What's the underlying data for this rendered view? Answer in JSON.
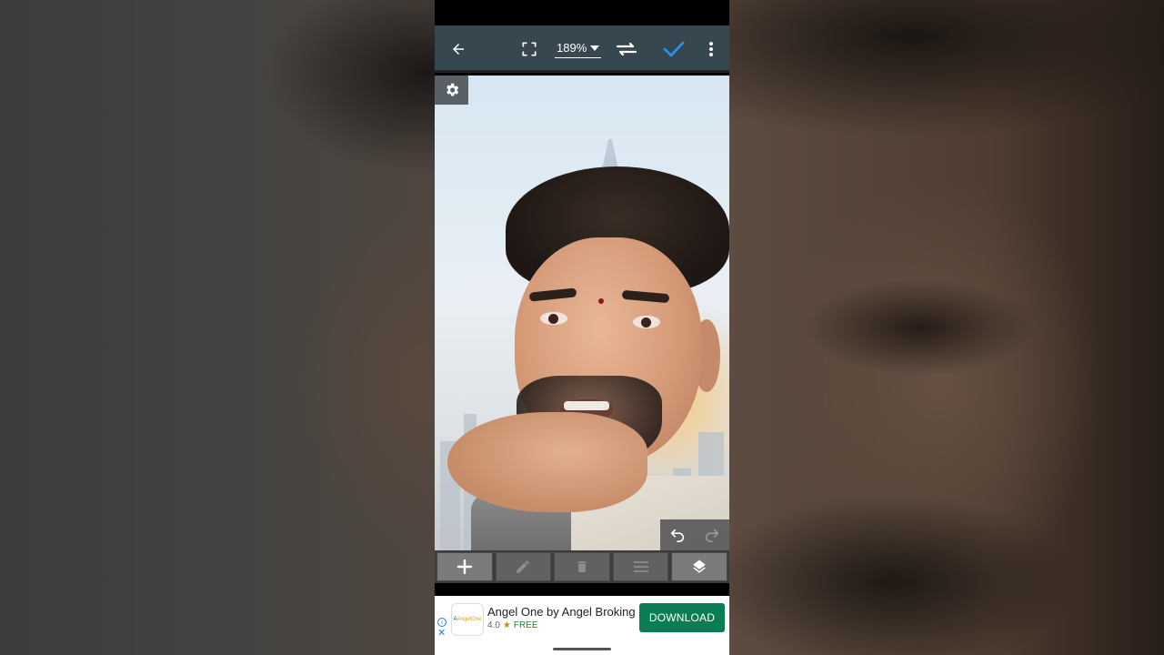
{
  "toolbar": {
    "back_icon": "arrow-left-icon",
    "fullscreen_icon": "fullscreen-icon",
    "zoom_level": "189%",
    "swap_icon": "swap-arrows-icon",
    "confirm_icon": "checkmark-icon",
    "menu_icon": "more-vert-icon",
    "accent_color": "#2196f3"
  },
  "canvas": {
    "settings_icon": "gear-icon",
    "undo_icon": "undo-icon",
    "redo_icon": "redo-icon"
  },
  "tools": [
    {
      "icon": "plus-icon",
      "enabled": true
    },
    {
      "icon": "pencil-icon",
      "enabled": false
    },
    {
      "icon": "trash-icon",
      "enabled": false
    },
    {
      "icon": "menu-lines-icon",
      "enabled": false
    },
    {
      "icon": "layers-icon",
      "enabled": true
    }
  ],
  "ad": {
    "logo_text_1": "A",
    "logo_text_2": "AngelOne",
    "title": "Angel One by Angel Broking",
    "rating": "4.0",
    "star": "★",
    "price": "FREE",
    "cta": "DOWNLOAD",
    "info": "i",
    "close": "✕",
    "cta_color": "#0a7d53"
  }
}
